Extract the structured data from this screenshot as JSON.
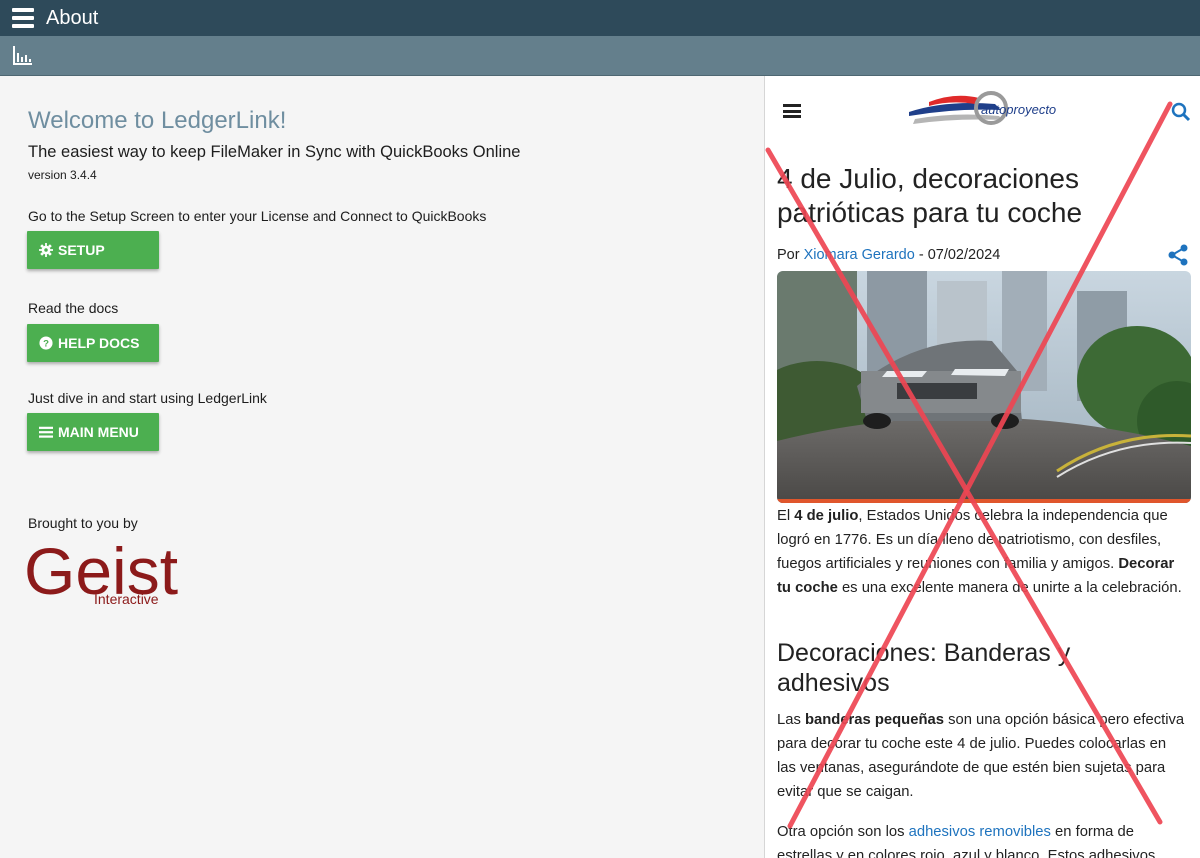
{
  "window": {
    "title": "About"
  },
  "left": {
    "welcome": "Welcome to LedgerLink!",
    "subtitle": "The easiest way to keep FileMaker in Sync with QuickBooks Online",
    "version": "version 3.4.4",
    "setup_caption": "Go to the Setup Screen to enter your License and Connect to QuickBooks",
    "setup_label": "SETUP",
    "docs_caption": "Read the docs",
    "docs_label": "HELP DOCS",
    "menu_caption": "Just dive in and start using LedgerLink",
    "menu_label": "MAIN MENU",
    "brought_by": "Brought to you by",
    "logo_text": "Geist",
    "logo_sub": "Interactive"
  },
  "article": {
    "site_logo": "autoproyecto",
    "headline": "4 de Julio, decoraciones patrióticas para tu coche",
    "by_prefix": "Por ",
    "author": "Xiomara Gerardo",
    "date_sep": " - ",
    "date": "07/02/2024",
    "p1": {
      "a": "El ",
      "b1": "4 de julio",
      "c": ", Estados Unidos celebra la independencia que logró en 1776. Es un día lleno de patriotismo, con desfiles, fuegos artificiales y reuniones con familia y amigos. ",
      "b2": "Decorar tu coche",
      "d": " es una excelente manera de unirte a la celebración."
    },
    "h2": "Decoraciones: Banderas y adhesivos",
    "p2": {
      "a": "Las ",
      "b": "banderas pequeñas",
      "c": " son una opción básica pero efectiva para decorar tu coche este 4 de julio. Puedes colocarlas en las ventanas, asegurándote de que estén bien sujetas para evitar que se caigan."
    },
    "p3": {
      "a": "Otra opción son los ",
      "link": "adhesivos removibles",
      "c": " en forma de estrellas y en colores rojo, azul y blanco. Estos adhesivos"
    }
  },
  "colors": {
    "title_bar": "#2e4a5a",
    "toolbar": "#647f8c",
    "button_green": "#4caf50",
    "welcome_text": "#6f8ea0",
    "link_blue": "#1e73be",
    "x_overlay": "#ee4653",
    "geist_red": "#8c1a1a"
  },
  "icons": {
    "menu": "hamburger-icon",
    "toolbar": "bar-chart-icon",
    "setup": "gear-icon",
    "docs": "question-circle-icon",
    "main_menu": "list-icon",
    "search": "search-icon",
    "share": "share-icon"
  }
}
